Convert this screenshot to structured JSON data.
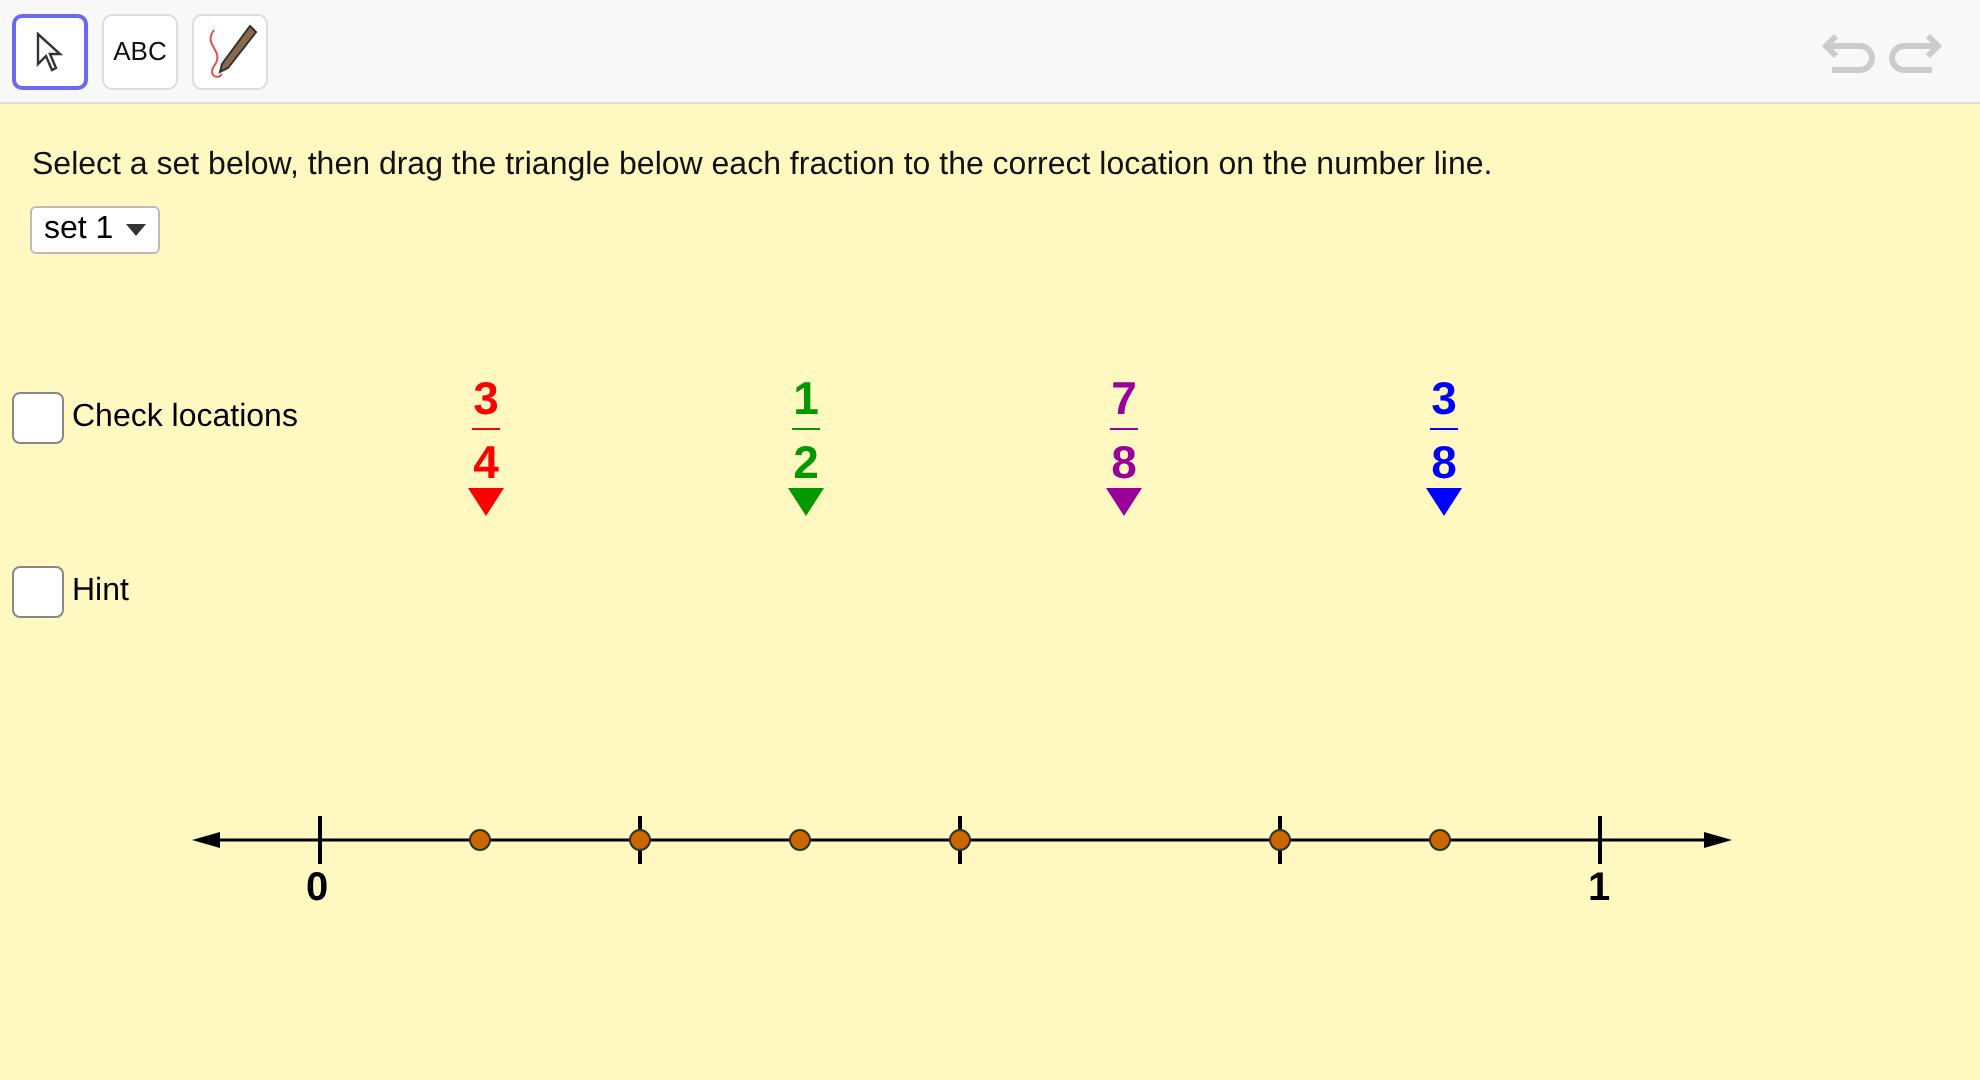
{
  "toolbar": {
    "tools": [
      {
        "kind": "move",
        "selected": true
      },
      {
        "kind": "text",
        "label": "ABC",
        "selected": false
      },
      {
        "kind": "pen",
        "selected": false
      }
    ]
  },
  "instruction": "Select a set below, then drag the triangle below each fraction to the correct location on the number line.",
  "set_dropdown": {
    "value": "set 1"
  },
  "checkboxes": [
    {
      "label": "Check locations",
      "checked": false
    },
    {
      "label": "Hint",
      "checked": false
    }
  ],
  "fractions": [
    {
      "numerator": "3",
      "denominator": "4",
      "color": "#ff0000"
    },
    {
      "numerator": "1",
      "denominator": "2",
      "color": "#009900"
    },
    {
      "numerator": "7",
      "denominator": "8",
      "color": "#990099"
    },
    {
      "numerator": "3",
      "denominator": "8",
      "color": "#0000ff"
    }
  ],
  "number_line": {
    "start_label": "0",
    "end_label": "1"
  }
}
